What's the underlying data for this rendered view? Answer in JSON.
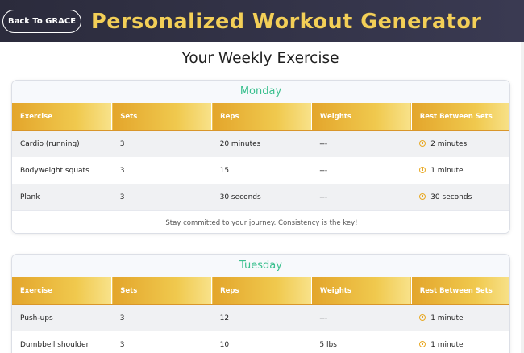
{
  "header": {
    "back_label": "Back To GRACE",
    "title": "Personalized Workout Generator",
    "accent_color": "#f3cf57",
    "bar_color": "#2b2b3c"
  },
  "page_heading": "Your Weekly Exercise",
  "columns": [
    "Exercise",
    "Sets",
    "Reps",
    "Weights",
    "Rest Between Sets"
  ],
  "days": [
    {
      "name": "Monday",
      "rows": [
        {
          "exercise": "Cardio (running)",
          "sets": "3",
          "reps": "20 minutes",
          "weights": "---",
          "rest": "2 minutes"
        },
        {
          "exercise": "Bodyweight squats",
          "sets": "3",
          "reps": "15",
          "weights": "---",
          "rest": "1 minute"
        },
        {
          "exercise": "Plank",
          "sets": "3",
          "reps": "30 seconds",
          "weights": "---",
          "rest": "30 seconds"
        }
      ],
      "footer": "Stay committed to your journey. Consistency is the key!"
    },
    {
      "name": "Tuesday",
      "rows": [
        {
          "exercise": "Push-ups",
          "sets": "3",
          "reps": "12",
          "weights": "---",
          "rest": "1 minute"
        },
        {
          "exercise": "Dumbbell shoulder",
          "sets": "3",
          "reps": "10",
          "weights": "5 lbs",
          "rest": "1 minute"
        }
      ]
    }
  ],
  "colors": {
    "day_title": "#3cc08f",
    "header_gold": "#e3a52b",
    "clock_icon": "#e8a822"
  },
  "icons": {
    "rest": "clock-icon"
  }
}
